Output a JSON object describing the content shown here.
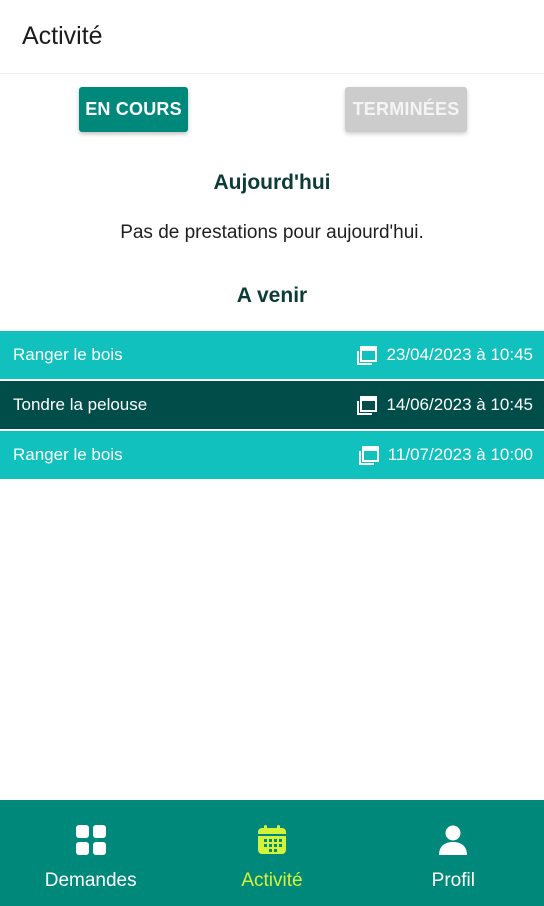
{
  "header": {
    "title": "Activité"
  },
  "tabs": [
    {
      "label": "EN COURS",
      "active": true
    },
    {
      "label": "TERMINÉES",
      "active": false
    }
  ],
  "today": {
    "title": "Aujourd'hui",
    "empty_message": "Pas de prestations pour aujourd'hui."
  },
  "upcoming": {
    "title": "A venir",
    "items": [
      {
        "label": "Ranger le bois",
        "date": "23/04/2023 à 10:45",
        "icon": "calendar-icon"
      },
      {
        "label": "Tondre la pelouse",
        "date": "14/06/2023 à 10:45",
        "icon": "calendar-icon"
      },
      {
        "label": "Ranger le bois",
        "date": "11/07/2023 à 10:00",
        "icon": "calendar-icon"
      }
    ]
  },
  "bottom_nav": {
    "items": [
      {
        "label": "Demandes",
        "icon": "grid-icon",
        "active": false
      },
      {
        "label": "Activité",
        "icon": "calendar-icon",
        "active": true
      },
      {
        "label": "Profil",
        "icon": "person-icon",
        "active": false
      }
    ]
  },
  "colors": {
    "primary": "#00897b",
    "row_light": "#11c1bd",
    "row_dark": "#004d4a",
    "nav_active": "#d4f23a",
    "tab_inactive": "#cccccc"
  }
}
